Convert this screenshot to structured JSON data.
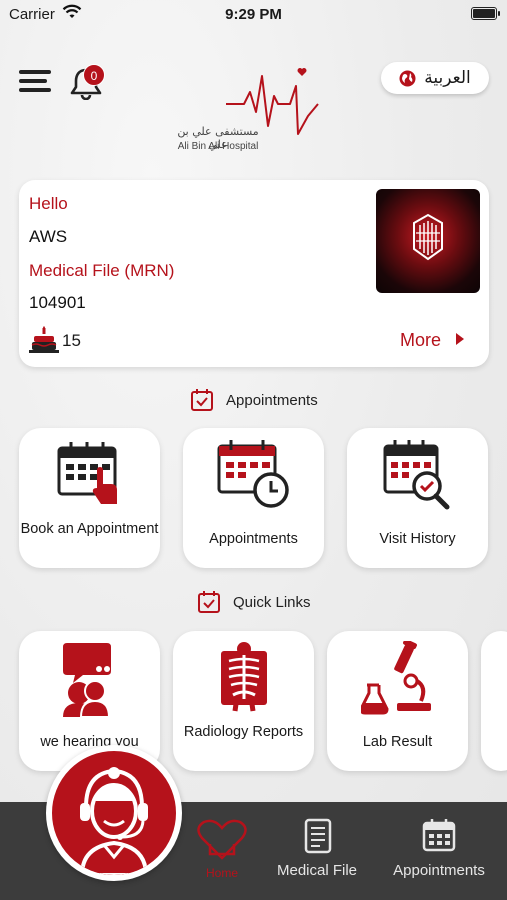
{
  "status_bar": {
    "carrier": "Carrier",
    "time": "9:29 PM"
  },
  "header": {
    "notification_count": "0",
    "logo_arabic": "مستشفى علي بن علي",
    "logo_english": "Ali Bin Ali Hospital",
    "language_button": "العربية"
  },
  "patient": {
    "greeting": "Hello",
    "name": "AWS",
    "mrn_label": "Medical File (MRN)",
    "mrn": "104901",
    "age": "15",
    "more_label": "More"
  },
  "appointments_section": {
    "title": "Appointments",
    "tiles": [
      {
        "label": "Book an Appointment",
        "icon": "book-appointment-icon"
      },
      {
        "label": "Appointments",
        "icon": "calendar-clock-icon"
      },
      {
        "label": "Visit History",
        "icon": "calendar-search-icon"
      }
    ]
  },
  "quick_links_section": {
    "title": "Quick Links",
    "tiles": [
      {
        "label": "we hearing you",
        "icon": "feedback-chat-icon"
      },
      {
        "label": "Radiology Reports",
        "icon": "xray-icon"
      },
      {
        "label": "Lab Result",
        "icon": "microscope-icon"
      }
    ]
  },
  "tab_bar": {
    "tabs": [
      {
        "label": "Home",
        "icon": "home-heart-icon",
        "active": true
      },
      {
        "label": "Medical File",
        "icon": "document-icon",
        "active": false
      },
      {
        "label": "Appointments",
        "icon": "calendar-icon",
        "active": false
      }
    ]
  },
  "colors": {
    "brand_red": "#b5121b",
    "tab_bar": "#3c3c3c",
    "background": "#efefef"
  }
}
